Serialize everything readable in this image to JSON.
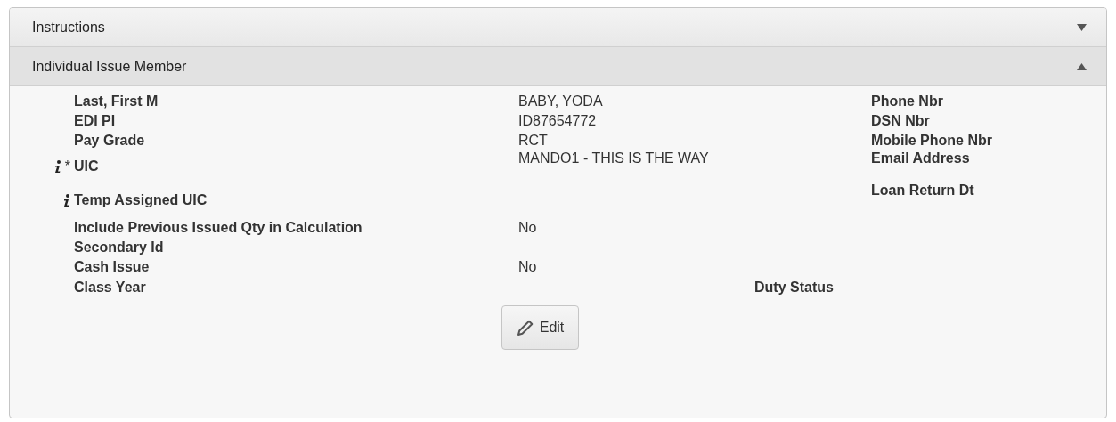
{
  "sections": [
    {
      "title": "Instructions",
      "expanded": false
    },
    {
      "title": "Individual Issue Member",
      "expanded": true
    }
  ],
  "fields": [
    {
      "label": "Last, First M",
      "value": "BABY, YODA",
      "info": false
    },
    {
      "label": "EDI PI",
      "value": "ID87654772",
      "info": false
    },
    {
      "label": "Pay Grade",
      "value": "RCT",
      "info": false
    },
    {
      "label": "UIC",
      "value": "MANDO1 - THIS IS THE WAY",
      "info": true,
      "required_mark": "*"
    },
    {
      "label": "Temp Assigned UIC",
      "info": true
    },
    {
      "label": "Include Previous Issued Qty in Calculation",
      "value": "No",
      "info": false
    },
    {
      "label": "Secondary Id",
      "info": false
    },
    {
      "label": "Cash Issue",
      "value": "No",
      "info": false
    },
    {
      "label": "Class Year",
      "info": false
    }
  ],
  "side_fields": [
    {
      "label": "Phone Nbr"
    },
    {
      "label": "DSN Nbr"
    },
    {
      "label": "Mobile Phone Nbr"
    },
    {
      "label": "Email Address"
    },
    {
      "label": "Loan Return Dt"
    }
  ],
  "duty_status": {
    "label": "Duty Status"
  },
  "edit_button": {
    "label": "Edit"
  }
}
